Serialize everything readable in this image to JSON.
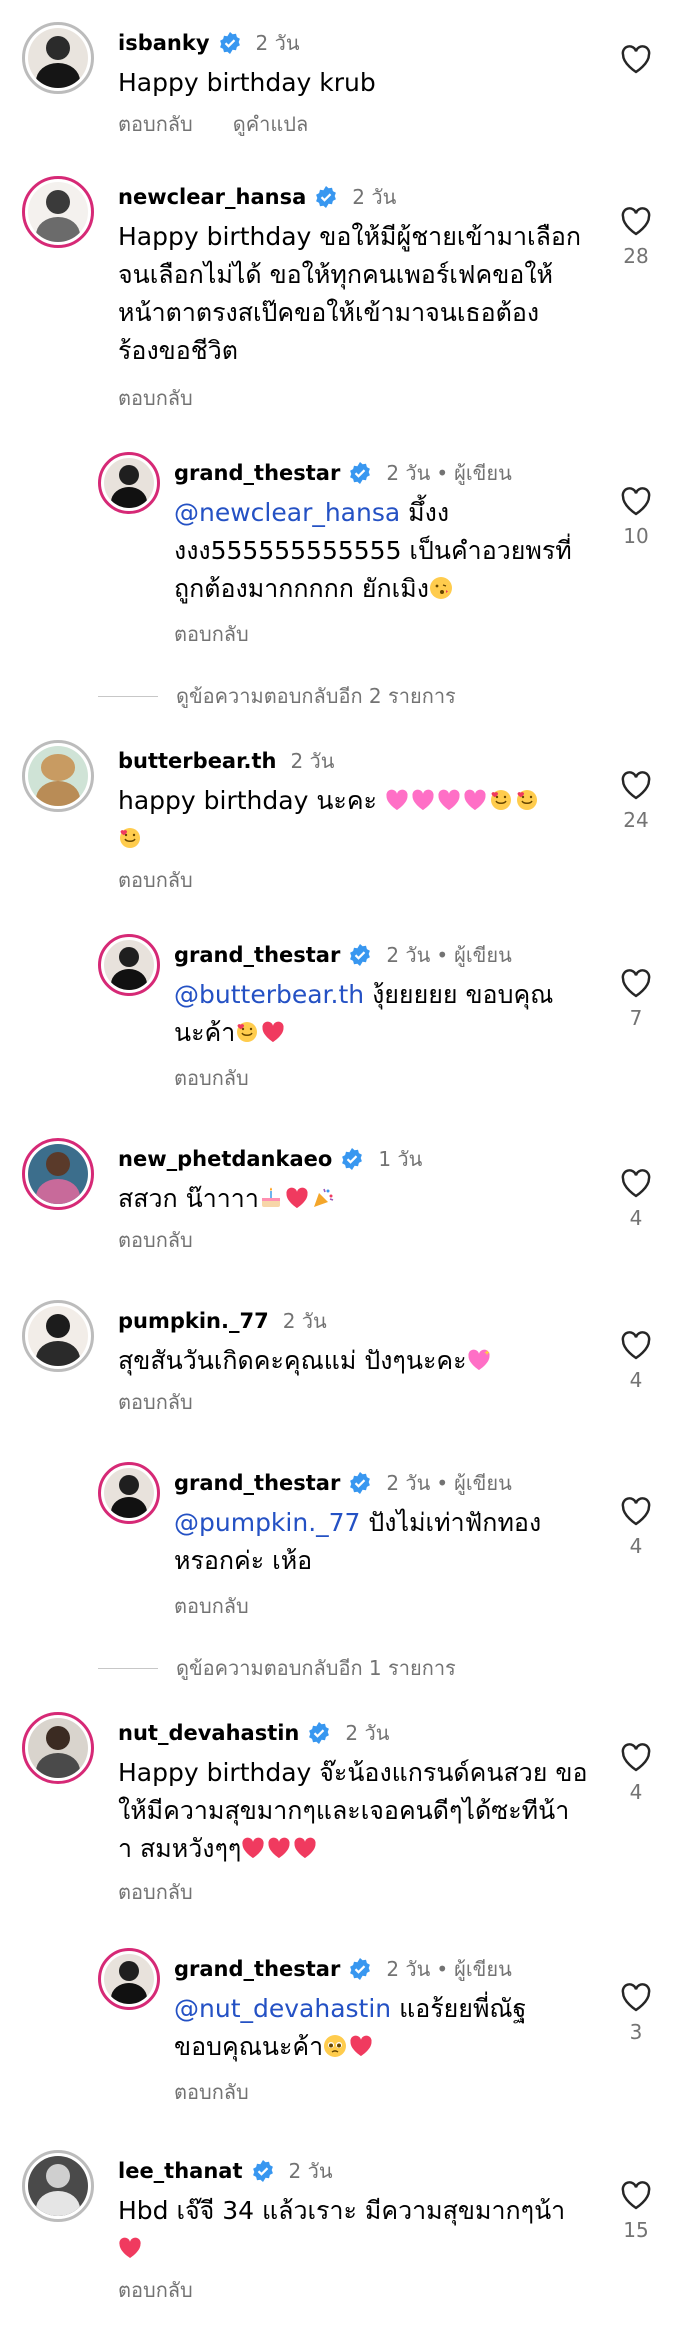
{
  "labels": {
    "reply": "ตอบกลับ",
    "translate": "ดูคำแปล",
    "author": "ผู้เขียน",
    "dot": "•"
  },
  "colors": {
    "verified": "#3897f0",
    "mention": "#2451c4",
    "secondary": "#737373",
    "heart_emoji": "#f03a5f",
    "pink_heart": "#ff6fc6"
  },
  "comments": [
    {
      "username": "isbanky",
      "time": "2 วัน",
      "lines": [
        "Happy birthday krub"
      ],
      "like_count": ""
    },
    {
      "username": "newclear_hansa",
      "time": "2 วัน",
      "lines": [
        "Happy birthday ขอให้มีผู้ชายเข้ามาเลือก",
        "จนเลือกไม่ได้ ขอให้ทุกคนเพอร์เฟคขอให้",
        "หน้าตาตรงสเป๊คขอให้เข้ามาจนเธอต้อง",
        "ร้องขอชีวิต"
      ],
      "like_count": "28"
    },
    {
      "username": "grand_thestar",
      "time": "2 วัน",
      "mention": "@newclear_hansa",
      "lines": [
        " มึ้งง",
        "งงง555555555555 เป็นคำอวยพรที่",
        "ถูกต้องมากกกกก ยักเมิง"
      ],
      "like_count": "10"
    },
    {
      "view_more": "ดูข้อความตอบกลับอีก 2 รายการ"
    },
    {
      "username": "butterbear.th",
      "time": "2 วัน",
      "lines": [
        "happy birthday นะคะ"
      ],
      "like_count": "24"
    },
    {
      "username": "grand_thestar",
      "time": "2 วัน",
      "mention": "@butterbear.th",
      "lines": [
        " งุ้ยยยยย ขอบคุณ",
        "นะค้า"
      ],
      "like_count": "7"
    },
    {
      "username": "new_phetdankaeo",
      "time": "1 วัน",
      "lines": [
        "สสวก น๊าาาา"
      ],
      "like_count": "4"
    },
    {
      "username": "pumpkin._77",
      "time": "2 วัน",
      "lines": [
        "สุขสันวันเกิดคะคุณแม่ ปังๆนะคะ"
      ],
      "like_count": "4"
    },
    {
      "username": "grand_thestar",
      "time": "2 วัน",
      "mention": "@pumpkin._77",
      "lines": [
        " ปังไม่เท่าฟักทอง",
        "หรอกค่ะ เห้อ"
      ],
      "like_count": "4"
    },
    {
      "view_more": "ดูข้อความตอบกลับอีก 1 รายการ"
    },
    {
      "username": "nut_devahastin",
      "time": "2 วัน",
      "lines": [
        "Happy birthday จ๊ะน้องแกรนด์คนสวย ขอ",
        "ให้มีความสุขมากๆและเจอคนดีๆได้ซะทีน้า",
        "า สมหวังๆๆ"
      ],
      "like_count": "4"
    },
    {
      "username": "grand_thestar",
      "time": "2 วัน",
      "mention": "@nut_devahastin",
      "lines": [
        " แอร้ยยพี่ณัฐ",
        "ขอบคุณนะค้า"
      ],
      "like_count": "3"
    },
    {
      "username": "lee_thanat",
      "time": "2 วัน",
      "lines": [
        "Hbd เจ๊จี 34 แล้วเราะ มีความสุขมากๆน้า"
      ],
      "like_count": "15"
    }
  ]
}
